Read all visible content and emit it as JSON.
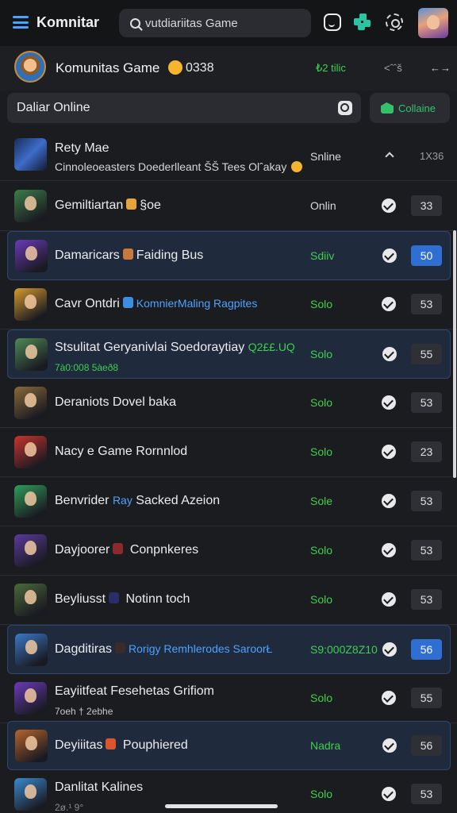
{
  "app": {
    "title": "Komnitar"
  },
  "search": {
    "value": "vutdiariitas Game"
  },
  "community": {
    "title": "Komunitas Game",
    "count": "0338",
    "stat": "₺2 tilic",
    "extra": "˂ˆˆš"
  },
  "filter": {
    "label": "Daliar Online"
  },
  "join_button": {
    "label": "Collaine"
  },
  "header_row": {
    "title": "Rety Mae",
    "subtitle": "Cinnoleoeasters Doederlleant ŠŠ Tees Olˆakay",
    "status": "Snline",
    "count": "1X36"
  },
  "rows": [
    {
      "title": "Gemiltiartan",
      "title_suffix": "§oe",
      "sub": "",
      "status": "Onlin",
      "badge": "33",
      "highlight": false,
      "status_color": "#d9d9dd",
      "thumb": "#3c7d4a",
      "hint": "#e8a33a"
    },
    {
      "title": "Damaricars",
      "title_suffix": "Faiding Bus",
      "sub": "",
      "status": "Sdiiv",
      "badge": "50",
      "highlight": true,
      "status_color": "#3fcf4e",
      "thumb": "#6a3ab8",
      "hint": "#c87a3a",
      "badge_blue": true
    },
    {
      "title": "Cavr Ontdri",
      "title_accent": "KomnierMaling Ragpites",
      "sub": "",
      "status": "Solo",
      "badge": "53",
      "highlight": false,
      "status_color": "#3fcf4e",
      "thumb": "#d69a2e",
      "hint": "#3f8de0"
    },
    {
      "title": "Stsulitat Geryanivlai Soedoraytiay",
      "title_accent": "Q2££.UQ",
      "sub": "7à0:008 5àeð8",
      "status": "Solo",
      "badge": "55",
      "highlight": true,
      "status_color": "#3fcf4e",
      "thumb": "#4f8a57",
      "hint": "",
      "accent_green": true,
      "two": true,
      "sub_color": "#3fcf4e"
    },
    {
      "title": "Deraniots Dovel baka",
      "title_suffix": "",
      "sub": "",
      "status": "Solo",
      "badge": "53",
      "highlight": false,
      "status_color": "#3fcf4e",
      "thumb": "#8a6a3a",
      "hint": ""
    },
    {
      "title": "Nacy e Game Rornnlod",
      "title_suffix": "",
      "sub": "",
      "status": "Solo",
      "badge": "23",
      "highlight": false,
      "status_color": "#3fcf4e",
      "thumb": "#c8342c",
      "hint": ""
    },
    {
      "title": "Benvrider",
      "title_accent": "Ray",
      "title_tail": "Sacked  Azeion",
      "sub": "",
      "status": "Sole",
      "badge": "53",
      "highlight": false,
      "status_color": "#3fcf4e",
      "thumb": "#2f9e5a",
      "hint": ""
    },
    {
      "title": "Dayjoorer",
      "title_tail": "Conpnkeres",
      "sub": "",
      "status": "Solo",
      "badge": "53",
      "highlight": false,
      "status_color": "#3fcf4e",
      "thumb": "#5a3a9a",
      "hint": "#8a2a2a"
    },
    {
      "title": "Beyliusst",
      "title_tail": "Notinn toch",
      "sub": "",
      "status": "Solo",
      "badge": "53",
      "highlight": false,
      "status_color": "#3fcf4e",
      "thumb": "#4a6a3a",
      "hint": "#2c2c6a"
    },
    {
      "title": "Dagditiras",
      "title_accent": "Rorigy Remhlerodes SaroorŁ",
      "sub": "",
      "status": "S9:000Z8Z10",
      "badge": "56",
      "highlight": true,
      "status_color": "#3fcf4e",
      "thumb": "#3a7ac8",
      "hint": "#3a2a2a",
      "badge_blue": true
    },
    {
      "title": "Eayiitfeat Fesehetas Grifiom",
      "title_suffix": "",
      "sub": "7oeh † 2ebhe",
      "status": "Solo",
      "badge": "55",
      "highlight": false,
      "status_color": "#3fcf4e",
      "thumb": "#6a3ab8",
      "hint": "",
      "two": true,
      "sub_color": "#c8c8cc"
    },
    {
      "title": "Deyiiitas",
      "title_tail": "Pouphiered",
      "sub": "",
      "status": "Nadra",
      "badge": "56",
      "highlight": true,
      "status_color": "#3fcf4e",
      "thumb": "#b8642c",
      "hint": "#d9562c"
    },
    {
      "title": "Danlitat Kalines",
      "title_suffix": "",
      "sub": "2ø.¹ 9°",
      "status": "Solo",
      "badge": "53",
      "highlight": false,
      "status_color": "#3fcf4e",
      "thumb": "#3a8ad0",
      "hint": "",
      "two": true,
      "sub_color": "#8a8a90"
    }
  ]
}
